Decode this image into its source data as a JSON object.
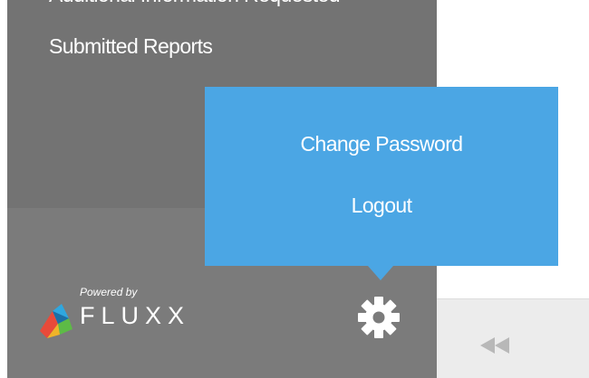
{
  "sidebar": {
    "nav_items": [
      {
        "label": "Additional Information Requested"
      },
      {
        "label": "Submitted Reports"
      }
    ],
    "footer": {
      "powered_by": "Powered by",
      "brand": "FLUXX",
      "settings_icon": "gear-icon",
      "logo_icon": "fluxx-logo-icon"
    }
  },
  "settings_menu": {
    "items": [
      {
        "label": "Change Password"
      },
      {
        "label": "Logout"
      }
    ],
    "color": "#4ba6e4"
  },
  "right_pane": {
    "collapse_icon": "rewind-icon"
  },
  "colors": {
    "sidebar": "#737373",
    "sidebar_footer": "#7b7b7b",
    "popover": "#4ba6e4"
  }
}
